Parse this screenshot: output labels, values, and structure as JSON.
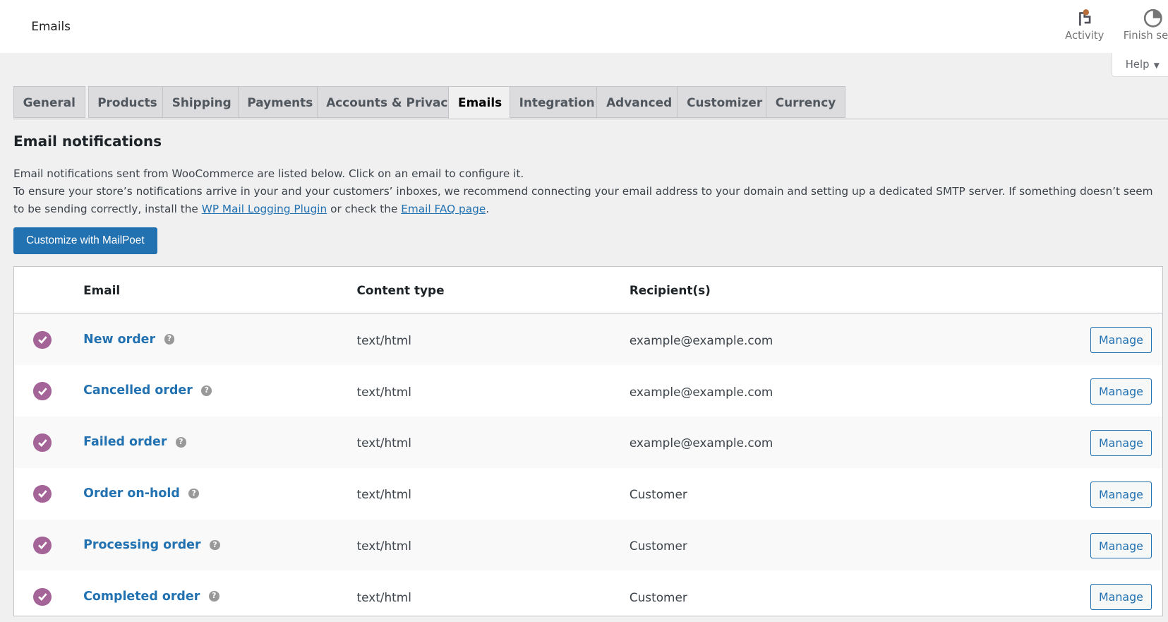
{
  "header": {
    "title": "Emails",
    "activity": "Activity",
    "finish_setup": "Finish setup",
    "help": "Help"
  },
  "tabs": [
    "General",
    "Products",
    "Shipping",
    "Payments",
    "Accounts & Privacy",
    "Emails",
    "Integration",
    "Advanced",
    "Customizer",
    "Currency"
  ],
  "active_tab": "Emails",
  "section": {
    "title": "Email notifications",
    "line1": "Email notifications sent from WooCommerce are listed below. Click on an email to configure it.",
    "line2_a": "To ensure your store’s notifications arrive in your and your customers’ inboxes, we recommend connecting your email address to your domain and setting up a dedicated SMTP server. If something doesn’t seem to be sending correctly, install the ",
    "link1": "WP Mail Logging Plugin",
    "line2_b": " or check the ",
    "link2": "Email FAQ page",
    "line2_c": ".",
    "cta": "Customize with MailPoet"
  },
  "table": {
    "headers": {
      "email": "Email",
      "content_type": "Content type",
      "recipients": "Recipient(s)"
    },
    "rows": [
      {
        "name": "New order",
        "type": "text/html",
        "recipient": "example@example.com",
        "action": "Manage",
        "enabled": true
      },
      {
        "name": "Cancelled order",
        "type": "text/html",
        "recipient": "example@example.com",
        "action": "Manage",
        "enabled": true
      },
      {
        "name": "Failed order",
        "type": "text/html",
        "recipient": "example@example.com",
        "action": "Manage",
        "enabled": true
      },
      {
        "name": "Order on-hold",
        "type": "text/html",
        "recipient": "Customer",
        "action": "Manage",
        "enabled": true
      },
      {
        "name": "Processing order",
        "type": "text/html",
        "recipient": "Customer",
        "action": "Manage",
        "enabled": true
      },
      {
        "name": "Completed order",
        "type": "text/html",
        "recipient": "Customer",
        "action": "Manage",
        "enabled": true
      }
    ]
  },
  "colors": {
    "accent": "#2271b1",
    "enabled_check": "#a46497",
    "activity_dot": "#b86e3a"
  }
}
